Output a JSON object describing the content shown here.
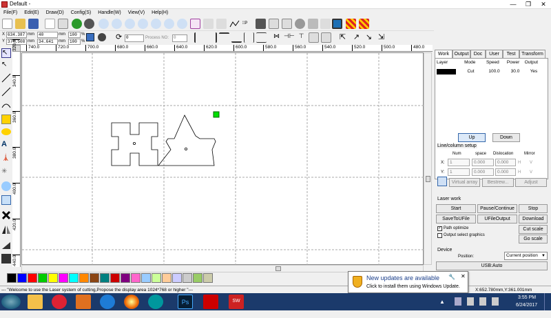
{
  "window": {
    "title": "Default -",
    "min": "—",
    "max": "❐",
    "close": "✕"
  },
  "menu": [
    "File(F)",
    "Edit(E)",
    "Draw(D)",
    "Config(S)",
    "Handle(W)",
    "View(V)",
    "Help(H)"
  ],
  "coords": {
    "x_label": "X",
    "x_value": "634.387",
    "x_unit": "mm",
    "w_value": "40",
    "w_unit": "mm",
    "w_pct": "100",
    "w_pct_unit": "%",
    "y_label": "Y",
    "y_value": "374.508",
    "y_unit": "mm",
    "h_value": "34.641",
    "h_unit": "mm",
    "h_pct": "100",
    "h_pct_unit": "%",
    "rotate_value": "0",
    "process_no_label": "Process NO:",
    "process_no_value": "0"
  },
  "hruler_ticks": [
    "740.0",
    "720.0",
    "700.0",
    "680.0",
    "660.0",
    "640.0",
    "620.0",
    "600.0",
    "580.0",
    "560.0",
    "540.0",
    "520.0",
    "500.0",
    "480.0"
  ],
  "vruler_ticks": [
    "320.0",
    "340.0",
    "360.0",
    "380.0",
    "400.0",
    "420.0",
    "440.0",
    "460.0"
  ],
  "palette": [
    "#000000",
    "#0000ff",
    "#ff0000",
    "#00cc00",
    "#ffff00",
    "#ff00ff",
    "#00ffff",
    "#ff8800",
    "#8b4513",
    "#008080",
    "#cc0000",
    "#800080",
    "#ff66cc",
    "#99ccff",
    "#ccff99",
    "#ffcc99",
    "#ccccff",
    "#cccccc",
    "#99cc66",
    "#ccccaa"
  ],
  "status_text": "--- \"Welcome to use the Laser system of cutting,Propose the display area 1024*768 or higher \"---",
  "status_coords": "X:652.780mm,Y:361.001mm",
  "tabs": [
    "Work",
    "Output",
    "Doc",
    "User",
    "Test",
    "Transform"
  ],
  "layer_table": {
    "headers": [
      "Layer",
      "Mode",
      "Speed",
      "Power",
      "Output"
    ],
    "rows": [
      {
        "color": "#000000",
        "mode": "Cut",
        "speed": "100.0",
        "power": "30.0",
        "output": "Yes"
      }
    ]
  },
  "buttons": {
    "up": "Up",
    "down": "Down",
    "virtual_array": "Virtual array",
    "bestrew": "Bestrew...",
    "adjust": "Adjust",
    "start": "Start",
    "pause": "Pause/Continue",
    "stop": "Stop",
    "save_to_ufile": "SaveToUFile",
    "ufile_output": "UFileOutput",
    "download": "Download",
    "cut_scale": "Cut scale",
    "go_scale": "Go scale",
    "usb": "USB:Auto"
  },
  "line_column": {
    "title": "Line/column setup",
    "headers": [
      "Num",
      "space",
      "Dislocation",
      "Mirror"
    ],
    "x_label": "X:",
    "x_num": "1",
    "x_space": "0.000",
    "x_disl": "0.000",
    "x_h": "H",
    "x_v": "V",
    "y_label": "Y:",
    "y_num": "1",
    "y_space": "0.000",
    "y_disl": "0.000",
    "y_h": "H",
    "y_v": "V"
  },
  "laser_work": {
    "title": "Laser work",
    "path_optimize": "Path optimize",
    "path_optimize_checked": true,
    "output_select": "Output select graphics",
    "output_select_checked": false
  },
  "device": {
    "title": "Device",
    "position_label": "Position:",
    "position_value": "Current position"
  },
  "notification": {
    "title": "New updates are available",
    "body": "Click to install them using Windows Update."
  },
  "clock": {
    "time": "3:55 PM",
    "date": "6/24/2017"
  }
}
